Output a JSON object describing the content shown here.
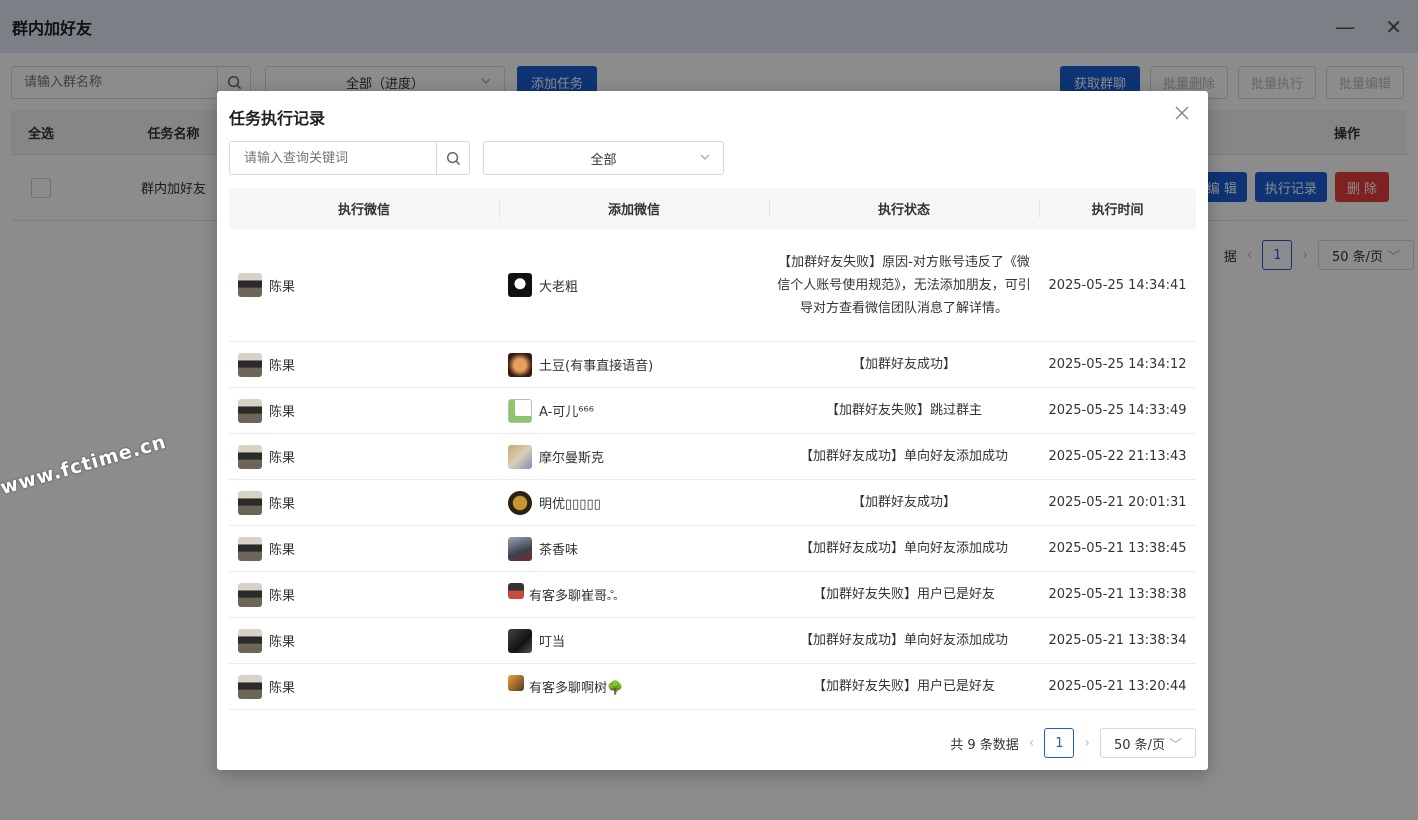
{
  "window": {
    "title": "群内加好友",
    "minimize": "—",
    "close": "✕"
  },
  "toolbar": {
    "search_placeholder": "请输入群名称",
    "progress_select": "全部（进度）",
    "add_task": "添加任务",
    "get_groups": "获取群聊",
    "batch_delete": "批量删除",
    "batch_execute": "批量执行",
    "batch_edit": "批量编辑"
  },
  "task_table": {
    "col_select_all": "全选",
    "col_task_name": "任务名称",
    "col_actions": "操作",
    "row_task_name": "群内加好友",
    "edit": "编 辑",
    "exec_record": "执行记录",
    "delete": "删 除",
    "total_tail": "据",
    "page": "1",
    "page_size": "50 条/页"
  },
  "watermark": "www.fctime.cn",
  "modal": {
    "title": "任务执行记录",
    "search_placeholder": "请输入查询关键词",
    "filter": "全部",
    "columns": {
      "exec_wechat": "执行微信",
      "added_wechat": "添加微信",
      "status": "执行状态",
      "time": "执行时间"
    },
    "rows": [
      {
        "exec": "陈果",
        "added": "大老粗",
        "status": "【加群好友失败】原因-对方账号违反了《微信个人账号使用规范》，无法添加朋友，可引导对方查看微信团队消息了解详情。",
        "time": "2025-05-25 14:34:41"
      },
      {
        "exec": "陈果",
        "added": "土豆(有事直接语音)",
        "status": "【加群好友成功】",
        "time": "2025-05-25 14:34:12"
      },
      {
        "exec": "陈果",
        "added": "A-可儿⁶⁶⁶",
        "status": "【加群好友失败】跳过群主",
        "time": "2025-05-25 14:33:49"
      },
      {
        "exec": "陈果",
        "added": "摩尔曼斯克",
        "status": "【加群好友成功】单向好友添加成功",
        "time": "2025-05-22 21:13:43"
      },
      {
        "exec": "陈果",
        "added": "明优▯▯▯▯▯",
        "status": "【加群好友成功】",
        "time": "2025-05-21 20:01:31"
      },
      {
        "exec": "陈果",
        "added": "茶香味",
        "status": "【加群好友成功】单向好友添加成功",
        "time": "2025-05-21 13:38:45"
      },
      {
        "exec": "陈果",
        "added": "有客多聊崔哥ஃ",
        "status": "【加群好友失败】用户已是好友",
        "time": "2025-05-21 13:38:38"
      },
      {
        "exec": "陈果",
        "added": "叮当",
        "status": "【加群好友成功】单向好友添加成功",
        "time": "2025-05-21 13:38:34"
      },
      {
        "exec": "陈果",
        "added": "有客多聊啊树🌳",
        "status": "【加群好友失败】用户已是好友",
        "time": "2025-05-21 13:20:44"
      }
    ],
    "pager": {
      "total": "共 9 条数据",
      "page": "1",
      "page_size": "50 条/页"
    }
  },
  "colors": {
    "primary": "#1a5fd6",
    "danger": "#e43d3d",
    "titlebar": "#dfe9f5"
  }
}
